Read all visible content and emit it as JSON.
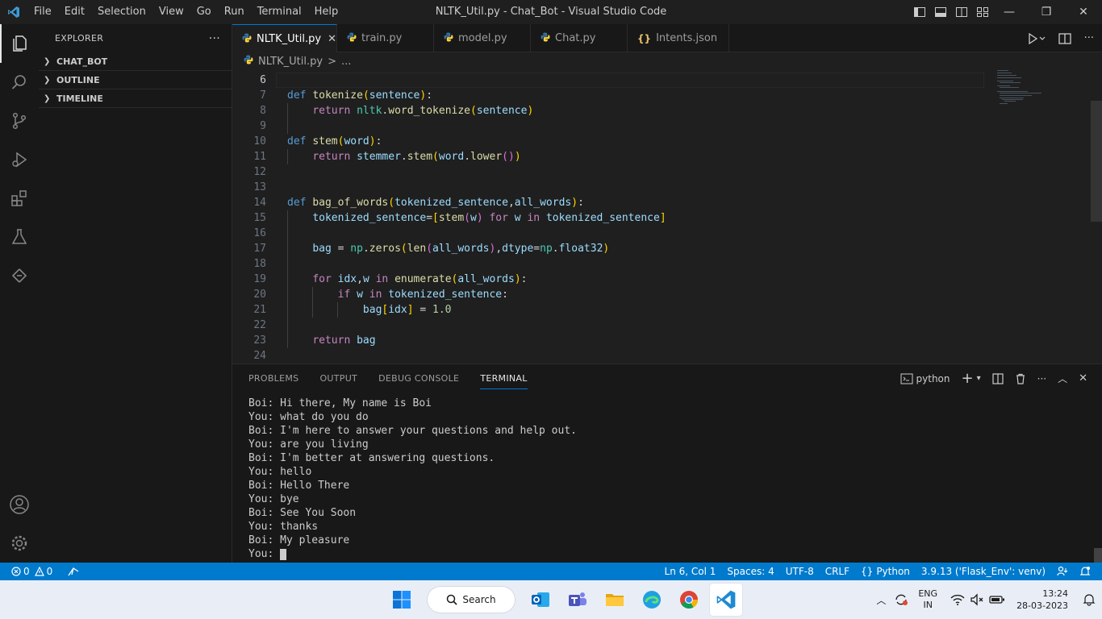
{
  "window": {
    "title": "NLTK_Util.py - Chat_Bot - Visual Studio Code",
    "menu": [
      "File",
      "Edit",
      "Selection",
      "View",
      "Go",
      "Run",
      "Terminal",
      "Help"
    ],
    "controls": {
      "minimize": "—",
      "maximize": "❐",
      "close": "✕"
    }
  },
  "activity_bar": [
    "explorer-icon",
    "search-icon",
    "source-control-icon",
    "run-debug-icon",
    "extensions-icon",
    "testing-icon",
    "remote-icon",
    "account-icon",
    "settings-gear-icon"
  ],
  "sidebar": {
    "title": "EXPLORER",
    "more": "···",
    "sections": [
      "CHAT_BOT",
      "OUTLINE",
      "TIMELINE"
    ]
  },
  "tabs": [
    {
      "label": "NLTK_Util.py",
      "icon": "python-icon",
      "active": true,
      "close": "✕"
    },
    {
      "label": "train.py",
      "icon": "python-icon"
    },
    {
      "label": "model.py",
      "icon": "python-icon"
    },
    {
      "label": "Chat.py",
      "icon": "python-icon"
    },
    {
      "label": "Intents.json",
      "icon": "json-icon",
      "glyph": "{}"
    }
  ],
  "breadcrumb": {
    "file": "NLTK_Util.py",
    "sep": ">",
    "rest": "..."
  },
  "editor": {
    "current_line": 6,
    "line_numbers": [
      "6",
      "7",
      "8",
      "9",
      "10",
      "11",
      "12",
      "13",
      "14",
      "15",
      "16",
      "17",
      "18",
      "19",
      "20",
      "21",
      "22",
      "23",
      "24"
    ]
  },
  "panel": {
    "tabs": [
      "PROBLEMS",
      "OUTPUT",
      "DEBUG CONSOLE",
      "TERMINAL"
    ],
    "active_tab": "TERMINAL",
    "shell": "python",
    "terminal_lines": [
      "Boi: Hi there, My name is Boi",
      "You: what do you do",
      "Boi: I'm here to answer your questions and help out.",
      "You: are you living",
      "Boi: I'm better at answering questions.",
      "You: hello",
      "Boi: Hello There",
      "You: bye",
      "Boi: See You Soon",
      "You: thanks",
      "Boi: My pleasure"
    ],
    "prompt": "You: "
  },
  "status_bar": {
    "errors": "0",
    "warnings": "0",
    "position": "Ln 6, Col 1",
    "spaces": "Spaces: 4",
    "encoding": "UTF-8",
    "eol": "CRLF",
    "language": "Python",
    "interpreter": "3.9.13 ('Flask_Env': venv)"
  },
  "taskbar": {
    "search": "Search",
    "lang_top": "ENG",
    "lang_bottom": "IN",
    "time": "13:24",
    "date": "28-03-2023"
  },
  "colors": {
    "accent": "#007acc",
    "editor_bg": "#1f1f1f",
    "sidebar_bg": "#181818"
  }
}
